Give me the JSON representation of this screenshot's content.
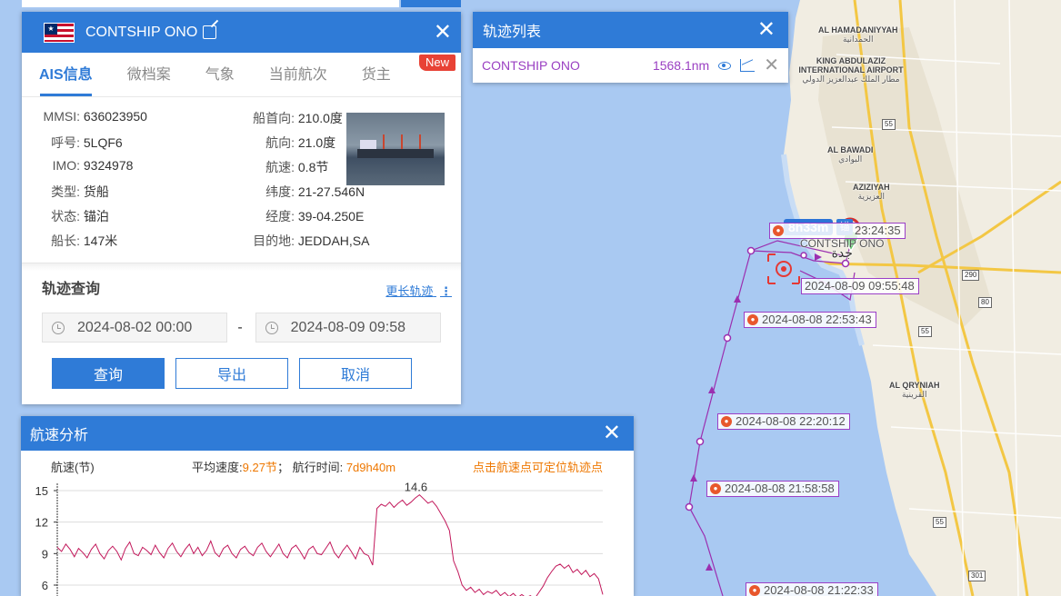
{
  "ship": {
    "name": "CONTSHIP ONO",
    "tabs": [
      "AIS信息",
      "微档案",
      "气象",
      "当前航次",
      "货主"
    ],
    "new_badge": "New",
    "info_left": [
      {
        "k": "MMSI:",
        "v": "636023950"
      },
      {
        "k": "呼号:",
        "v": "5LQF6"
      },
      {
        "k": "IMO:",
        "v": "9324978"
      },
      {
        "k": "类型:",
        "v": "货船"
      },
      {
        "k": "状态:",
        "v": "锚泊"
      },
      {
        "k": "船长:",
        "v": "147米"
      }
    ],
    "info_right": [
      {
        "k": "船首向:",
        "v": "210.0度"
      },
      {
        "k": "航向:",
        "v": "21.0度"
      },
      {
        "k": "航速:",
        "v": "0.8节"
      },
      {
        "k": "纬度:",
        "v": "21-27.546N"
      },
      {
        "k": "经度:",
        "v": "39-04.250E"
      },
      {
        "k": "目的地:",
        "v": "JEDDAH,SA"
      }
    ]
  },
  "track_query": {
    "title": "轨迹查询",
    "longer_link": "更长轨迹",
    "start": "2024-08-02 00:00",
    "sep": "-",
    "end": "2024-08-09 09:58",
    "buttons": {
      "query": "查询",
      "export": "导出",
      "cancel": "取消"
    }
  },
  "track_list": {
    "title": "轨迹列表",
    "row": {
      "name": "CONTSHIP ONO",
      "length": "1568.1nm"
    }
  },
  "speed_analysis": {
    "title": "航速分析",
    "unit_label": "航速(节)",
    "avg_label": "平均速度:",
    "avg_value": "9.27节",
    "separator": "；",
    "time_label": "航行时间:",
    "time_value": "7d9h40m",
    "hint": "点击航速点可定位轨迹点",
    "max_label": "14.6"
  },
  "chart_data": {
    "type": "line",
    "title": "",
    "ylabel": "航速(节)",
    "yticks": [
      6,
      9,
      12,
      15
    ],
    "ylim": [
      4,
      15
    ],
    "series": [
      {
        "values": [
          9.6,
          9.2,
          9.9,
          9.4,
          8.7,
          9.5,
          9.1,
          8.6,
          9.4,
          9.9,
          9.0,
          8.5,
          9.3,
          9.7,
          9.2,
          8.4,
          9.5,
          10.1,
          9.0,
          8.8,
          9.6,
          9.3,
          8.9,
          9.8,
          9.1,
          8.6,
          9.5,
          10.0,
          9.2,
          8.7,
          9.4,
          9.9,
          9.0,
          9.6,
          8.8,
          9.3,
          10.2,
          9.1,
          8.7,
          9.5,
          9.8,
          9.0,
          8.6,
          9.4,
          9.7,
          9.1,
          8.8,
          9.6,
          10.0,
          9.2,
          8.7,
          9.3,
          9.9,
          9.0,
          8.6,
          9.5,
          9.8,
          9.2,
          8.5,
          9.4,
          9.7,
          9.0,
          8.9,
          9.5,
          10.1,
          9.1,
          8.6,
          9.3,
          9.8,
          9.2,
          8.5,
          9.6,
          9.0,
          8.8,
          7.9,
          13.3,
          13.7,
          13.5,
          13.9,
          13.4,
          13.8,
          14.1,
          13.6,
          13.9,
          14.3,
          14.6,
          14.2,
          13.8,
          14.0,
          13.5,
          12.8,
          12.1,
          11.2,
          8.3,
          7.3,
          6.0,
          5.5,
          5.8,
          5.3,
          5.6,
          5.1,
          5.4,
          5.2,
          5.5,
          5.0,
          5.3,
          4.9,
          5.2,
          4.8,
          5.1,
          4.8,
          5.0,
          4.7,
          5.3,
          5.9,
          6.7,
          7.3,
          7.8,
          8.0,
          7.6,
          7.9,
          7.2,
          7.5,
          7.0,
          7.4,
          6.8,
          7.1,
          6.6,
          5.1
        ]
      }
    ]
  },
  "map": {
    "labels": [
      {
        "en": "AL HAMADANIYYAH",
        "ar": "الحمدانية"
      },
      {
        "en": "KING ABDULAZIZ INTERNATIONAL AIRPORT",
        "ar": "مطار الملك عبدالعزيز الدولي"
      },
      {
        "en": "AL BAWADI",
        "ar": "البوادي"
      },
      {
        "en": "AZIZIYAH",
        "ar": "العزيزية"
      },
      {
        "en": "AL QRYNIAH",
        "ar": "القرينية"
      },
      {
        "en": "CONTSHIP ONO",
        "ar": "جدة"
      }
    ],
    "road_shields": [
      "55",
      "290",
      "80",
      "55",
      "55",
      "301"
    ],
    "duration_badge": "8h33m",
    "anchor_glyph": "锚",
    "track_labels": [
      "23:24:35",
      "2024-08-09 09:55:48",
      "2024-08-08 22:53:43",
      "2024-08-08 22:20:12",
      "2024-08-08 21:58:58",
      "2024-08-08 21:22:33"
    ]
  }
}
